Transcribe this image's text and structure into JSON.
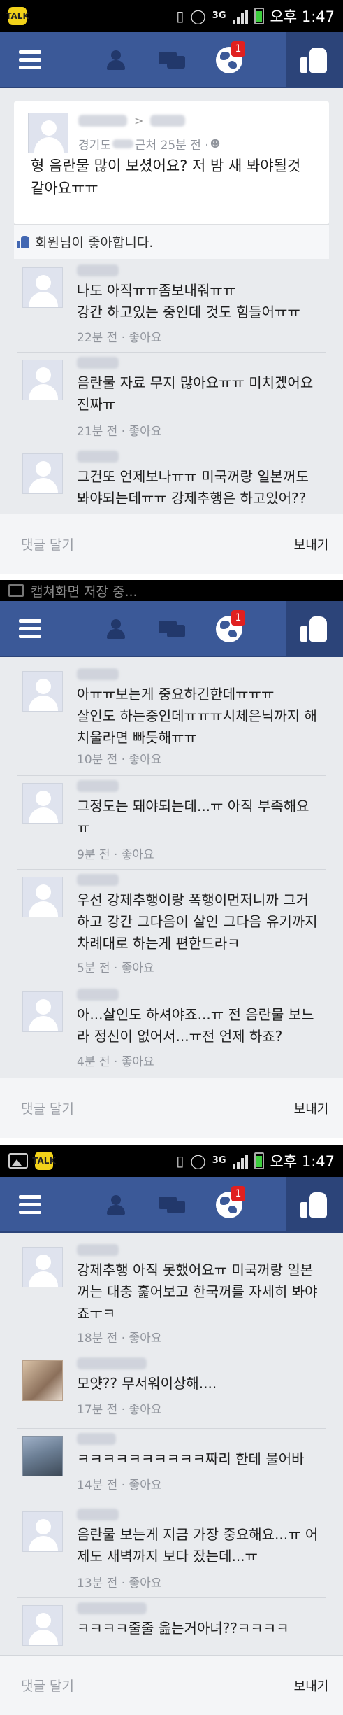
{
  "screens": [
    {
      "status": {
        "time": "오후 1:47",
        "network": "3G"
      },
      "post": {
        "location": "경기도",
        "time_suffix": "근처 25분 전 ·",
        "text": "형 음란물 많이 보셨어요? 저 밤 새 봐야될것같아요ㅠㅠ",
        "likes_text": "회원님이 좋아합니다."
      },
      "comments": [
        {
          "text": "나도 아직ㅠㅠ좀보내줘ㅠㅠ\n강간 하고있는 중인데 것도 힘들어ㅠㅠ",
          "time": "22분 전",
          "like": "좋아요"
        },
        {
          "text": "음란물 자료 무지 많아요ㅠㅠ 미치겠어요 진짜ㅠ",
          "time": "21분 전",
          "like": "좋아요"
        },
        {
          "text": "그건또 언제보나ㅠㅠ 미국꺼랑 일본꺼도 봐야되는데ㅠㅠ 강제추행은 하고있어??",
          "time": "",
          "like": ""
        }
      ],
      "reply": {
        "placeholder": "댓글 달기",
        "send": "보내기"
      }
    },
    {
      "notification": "캡쳐화면 저장 중...",
      "comments": [
        {
          "text": "아ㅠㅠ보는게 중요하긴한데ㅠㅠㅠ\n살인도 하는중인데ㅠㅠㅠ시체은닉까지 해치울라면 빠듯해ㅠㅠ",
          "time": "10분 전",
          "like": "좋아요"
        },
        {
          "text": "그정도는 돼야되는데...ㅠ 아직 부족해요ㅠ",
          "time": "9분 전",
          "like": "좋아요"
        },
        {
          "text": "우선 강제추행이랑 폭행이먼저니까 그거하고 강간 그다음이 살인 그다음 유기까지 차례대로 하는게 편한드라ㅋ",
          "time": "5분 전",
          "like": "좋아요"
        },
        {
          "text": "아...살인도 하셔야죠...ㅠ 전 음란물 보느라 정신이 없어서...ㅠ전 언제 하죠?",
          "time": "4분 전",
          "like": "좋아요"
        }
      ],
      "reply": {
        "placeholder": "댓글 달기",
        "send": "보내기"
      }
    },
    {
      "status": {
        "time": "오후 1:47",
        "network": "3G"
      },
      "comments": [
        {
          "text": "강제추행 아직 못했어요ㅠ 미국꺼랑 일본꺼는 대충 훑어보고 한국꺼를 자세히 봐야죠ㅜㅋ",
          "time": "18분 전",
          "like": "좋아요"
        },
        {
          "text": "모얏?? 무서워이상해....",
          "time": "17분 전",
          "like": "좋아요"
        },
        {
          "text": "ㅋㅋㅋㅋㅋㅋㅋㅋㅋㅋ짜리 한테 물어바",
          "time": "14분 전",
          "like": "좋아요"
        },
        {
          "text": "음란물 보는게 지금 가장 중요해요...ㅠ 어제도 새벽까지 보다 잤는데...ㅠ",
          "time": "13분 전",
          "like": "좋아요"
        },
        {
          "text": "ㅋㅋㅋㅋ줄줄 읊는거아녀??ㅋㅋㅋㅋ",
          "time": "",
          "like": ""
        }
      ],
      "reply": {
        "placeholder": "댓글 달기",
        "send": "보내기"
      }
    }
  ],
  "badge_count": "1"
}
